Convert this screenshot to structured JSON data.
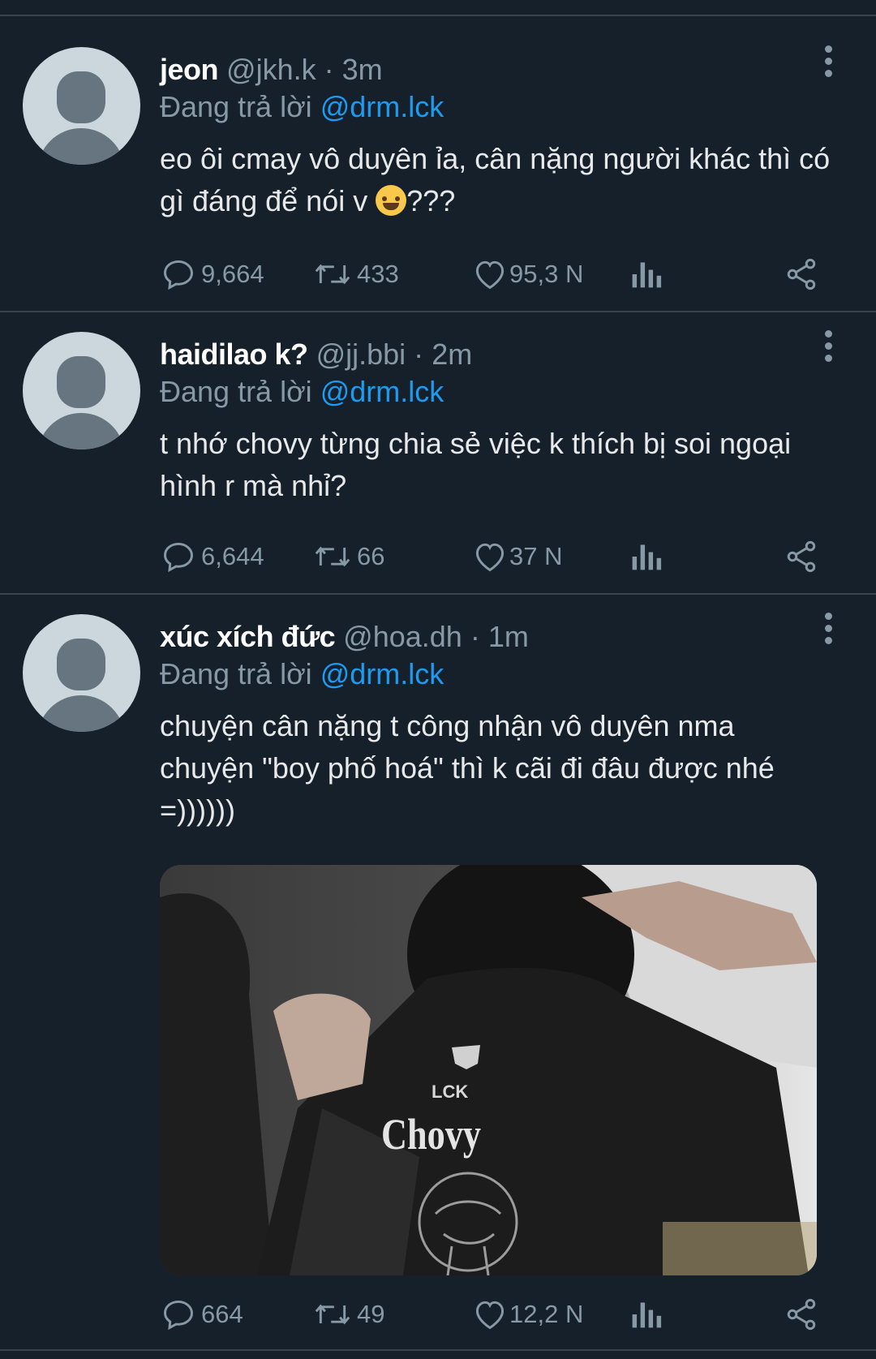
{
  "replying_prefix": "Đang trả lời",
  "tweets": [
    {
      "name": "jeon",
      "handle": "@jkh.k",
      "separator": "·",
      "time": "3m",
      "reply_to": "@drm.lck",
      "text_line1": "eo ôi cmay vô duyên ỉa, cân nặng người khác thì có",
      "text_line2a": "gì đáng để nói v ",
      "emoji": "😅",
      "text_line2b": "???",
      "replies": "9,664",
      "retweets": "433",
      "likes": "95,3 N"
    },
    {
      "name": "haidilao k?",
      "handle": "@jj.bbi",
      "separator": "·",
      "time": "2m",
      "reply_to": "@drm.lck",
      "text_line1": "t nhớ chovy từng chia sẻ việc k thích bị soi ngoại",
      "text_line2": "hình r mà nhỉ?",
      "replies": "6,644",
      "retweets": "66",
      "likes": "37 N"
    },
    {
      "name": "xúc xích đức",
      "handle": "@hoa.dh",
      "separator": "·",
      "time": "1m",
      "reply_to": "@drm.lck",
      "text_line1": "chuyện cân nặng t công nhận vô duyên nma",
      "text_line2": "chuyện \"boy phố hoá\" thì k cãi đi đâu được nhé",
      "text_line3": "=))))))",
      "image": {
        "jersey_brand": "LCK",
        "jersey_name": "Chovy"
      },
      "replies": "664",
      "retweets": "49",
      "likes": "12,2 N"
    }
  ],
  "colors": {
    "background": "#15202b",
    "divider": "#38444d",
    "muted": "#8899a6",
    "mention": "#1d9bf0",
    "text": "#e7e9ea"
  },
  "icons": [
    "reply-icon",
    "retweet-icon",
    "like-icon",
    "analytics-icon",
    "share-icon",
    "more-options-icon"
  ]
}
